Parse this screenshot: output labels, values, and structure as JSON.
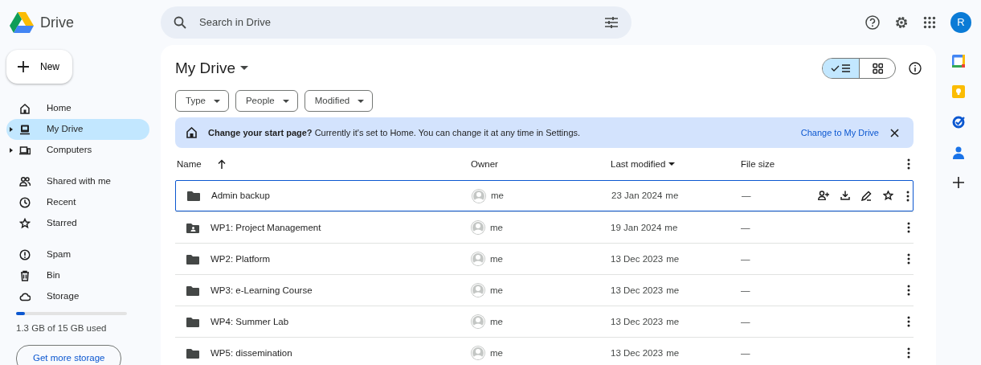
{
  "app": {
    "title": "Drive"
  },
  "search": {
    "placeholder": "Search in Drive"
  },
  "account": {
    "initial": "R"
  },
  "new_button": {
    "label": "New"
  },
  "sidebar": {
    "sections": [
      [
        {
          "label": "Home",
          "selected": false,
          "expandable": false
        },
        {
          "label": "My Drive",
          "selected": true,
          "expandable": true
        },
        {
          "label": "Computers",
          "selected": false,
          "expandable": true
        }
      ],
      [
        {
          "label": "Shared with me",
          "selected": false,
          "expandable": false
        },
        {
          "label": "Recent",
          "selected": false,
          "expandable": false
        },
        {
          "label": "Starred",
          "selected": false,
          "expandable": false
        }
      ],
      [
        {
          "label": "Spam",
          "selected": false,
          "expandable": false
        },
        {
          "label": "Bin",
          "selected": false,
          "expandable": false
        },
        {
          "label": "Storage",
          "selected": false,
          "expandable": false
        }
      ]
    ]
  },
  "storage": {
    "level": 0.08,
    "usage": "1.3 GB of 15 GB used",
    "button": "Get more storage"
  },
  "page_title": "My Drive",
  "view_toggle": [
    {
      "kind": "list",
      "selected": true
    },
    {
      "kind": "grid",
      "selected": false
    }
  ],
  "filters": [
    "Type",
    "People",
    "Modified"
  ],
  "banner": {
    "message": "**Change your start page?** Currently it's set to Home. You can change it at any time in Settings.",
    "action": "Change to My Drive"
  },
  "table": {
    "columns": [
      {
        "label": "Name",
        "kind": "ascending"
      },
      {
        "label": "Owner",
        "kind": "plain"
      },
      {
        "label": "Last modified",
        "kind": "descending"
      },
      {
        "label": "File size",
        "kind": "plain"
      }
    ],
    "rows": [
      {
        "name": "Admin backup",
        "kind": "folder",
        "owner": "me",
        "modified": "23 Jan 2024",
        "modified_by": "me",
        "size": "—",
        "selected": true
      },
      {
        "name": "WP1: Project Management",
        "kind": "shared-folder",
        "owner": "me",
        "modified": "19 Jan 2024",
        "modified_by": "me",
        "size": "—",
        "selected": false
      },
      {
        "name": "WP2: Platform",
        "kind": "folder",
        "owner": "me",
        "modified": "13 Dec 2023",
        "modified_by": "me",
        "size": "—",
        "selected": false
      },
      {
        "name": "WP3: e-Learning Course",
        "kind": "folder",
        "owner": "me",
        "modified": "13 Dec 2023",
        "modified_by": "me",
        "size": "—",
        "selected": false
      },
      {
        "name": "WP4: Summer Lab",
        "kind": "folder",
        "owner": "me",
        "modified": "13 Dec 2023",
        "modified_by": "me",
        "size": "—",
        "selected": false
      },
      {
        "name": "WP5: dissemination",
        "kind": "folder",
        "owner": "me",
        "modified": "13 Dec 2023",
        "modified_by": "me",
        "size": "—",
        "selected": false
      }
    ]
  }
}
